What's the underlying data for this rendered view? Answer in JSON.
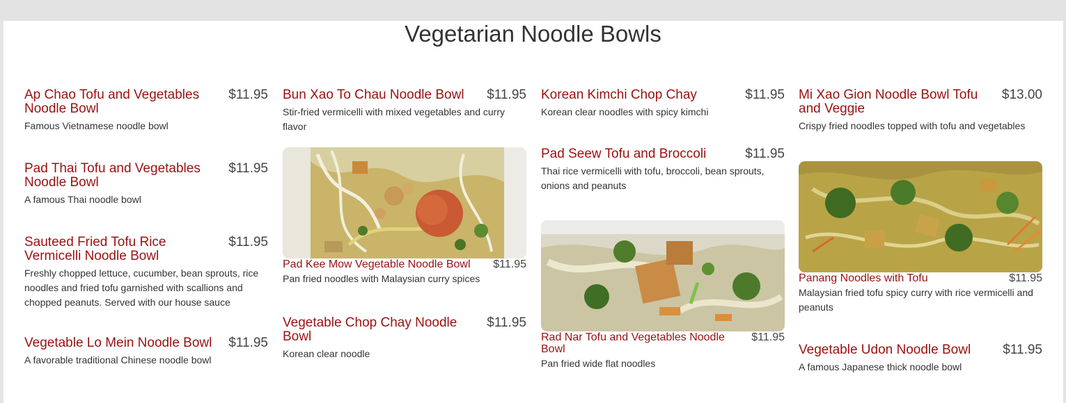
{
  "page": {
    "title": "Vegetarian Noodle Bowls"
  },
  "colors": {
    "name": "#9b1111",
    "price": "#444444",
    "text": "#333333",
    "background": "#ffffff"
  },
  "items": [
    {
      "name": "Ap Chao Tofu and Vegetables Noodle Bowl",
      "price": "$11.95",
      "description": "Famous Vietnamese noodle bowl"
    },
    {
      "name": "Pad Thai Tofu and Vegetables Noodle Bowl",
      "price": "$11.95",
      "description": "A famous Thai noodle bowl"
    },
    {
      "name": "Sauteed Fried Tofu Rice Vermicelli Noodle Bowl",
      "price": "$11.95",
      "description": "Freshly chopped lettuce, cucumber, bean sprouts, rice noodles and fried tofu garnished with scallions and chopped peanuts. Served with our house sauce"
    },
    {
      "name": "Vegetable Lo Mein Noodle Bowl",
      "price": "$11.95",
      "description": "A favorable traditional Chinese noodle bowl"
    },
    {
      "name": "Bun Xao To Chau Noodle Bowl",
      "price": "$11.95",
      "description": "Stir-fried vermicelli with mixed vegetables and curry flavor"
    },
    {
      "name": "Pad Kee Mow Vegetable Noodle Bowl",
      "price": "$11.95",
      "description": "Pan fried noodles with Malaysian curry spices"
    },
    {
      "name": "Vegetable Chop Chay Noodle Bowl",
      "price": "$11.95",
      "description": "Korean clear noodle"
    },
    {
      "name": "Korean Kimchi Chop Chay",
      "price": "$11.95",
      "description": "Korean clear noodles with spicy kimchi"
    },
    {
      "name": "Pad Seew Tofu and Broccoli",
      "price": "$11.95",
      "description": "Thai rice vermicelli with tofu, broccoli, bean sprouts, onions and peanuts"
    },
    {
      "name": "Rad Nar Tofu and Vegetables Noodle Bowl",
      "price": "$11.95",
      "description": "Pan fried wide flat noodles"
    },
    {
      "name": "Mi Xao Gion Noodle Bowl Tofu and Veggie",
      "price": "$13.00",
      "description": "Crispy fried noodles topped with tofu and vegetables"
    },
    {
      "name": "Panang Noodles with Tofu",
      "price": "$11.95",
      "description": "Malaysian fried tofu spicy curry with rice vermicelli and peanuts"
    },
    {
      "name": "Vegetable Udon Noodle Bowl",
      "price": "$11.95",
      "description": "A famous Japanese thick noodle bowl"
    }
  ]
}
